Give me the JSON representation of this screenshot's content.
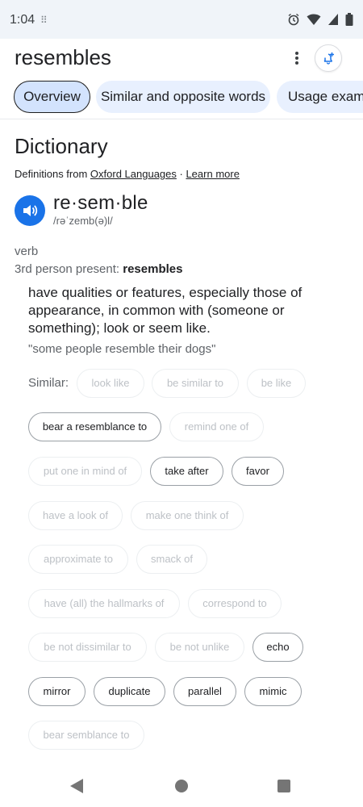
{
  "status": {
    "time": "1:04",
    "dots": "⠿",
    "icons": [
      "alarm-icon",
      "wifi-icon",
      "signal-icon",
      "battery-icon"
    ]
  },
  "header": {
    "query": "resembles",
    "menu_icon": "more-vert-icon",
    "alert_icon": "notification-add-icon"
  },
  "tabs": [
    {
      "label": "Overview",
      "active": true
    },
    {
      "label": "Similar and opposite words",
      "active": false
    },
    {
      "label": "Usage examples",
      "active": false
    }
  ],
  "dictionary": {
    "title": "Dictionary",
    "defs_prefix": "Definitions from ",
    "source": "Oxford Languages",
    "separator": " · ",
    "learn_more": "Learn more",
    "speaker_icon": "volume-icon",
    "headword": "re·sem·ble",
    "phonetic": "/rəˈzemb(ə)l/",
    "part_of_speech": "verb",
    "third_person_label": "3rd person present: ",
    "third_person_value": "resembles",
    "definition": "have qualities or features, especially those of appearance, in common with (someone or something); look or seem like.",
    "example": "\"some people resemble their dogs\"",
    "similar_label": "Similar:",
    "similar": [
      {
        "label": "look like",
        "active": false
      },
      {
        "label": "be similar to",
        "active": false
      },
      {
        "label": "be like",
        "active": false
      },
      {
        "label": "bear a resemblance to",
        "active": true
      },
      {
        "label": "remind one of",
        "active": false
      },
      {
        "label": "put one in mind of",
        "active": false
      },
      {
        "label": "take after",
        "active": true
      },
      {
        "label": "favor",
        "active": true
      },
      {
        "label": "have a look of",
        "active": false
      },
      {
        "label": "make one think of",
        "active": false
      },
      {
        "label": "approximate to",
        "active": false
      },
      {
        "label": "smack of",
        "active": false
      },
      {
        "label": "have (all) the hallmarks of",
        "active": false
      },
      {
        "label": "correspond to",
        "active": false
      },
      {
        "label": "be not dissimilar to",
        "active": false
      },
      {
        "label": "be not unlike",
        "active": false
      },
      {
        "label": "echo",
        "active": true
      },
      {
        "label": "mirror",
        "active": true
      },
      {
        "label": "duplicate",
        "active": true
      },
      {
        "label": "parallel",
        "active": true
      },
      {
        "label": "mimic",
        "active": true
      },
      {
        "label": "bear semblance to",
        "active": false
      }
    ]
  },
  "navbar": {
    "back_icon": "back-triangle-icon",
    "home_icon": "home-circle-icon",
    "recents_icon": "recents-square-icon"
  }
}
